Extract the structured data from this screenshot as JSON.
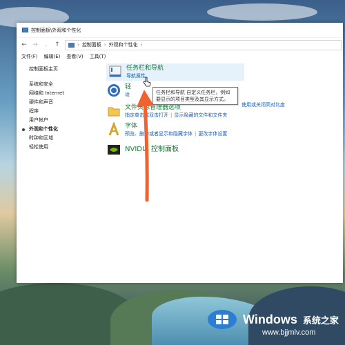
{
  "window": {
    "title": "控制面板\\外观和个性化"
  },
  "address": {
    "crumbs": [
      "控制面板",
      "外观和个性化"
    ]
  },
  "menu": [
    "文件(F)",
    "编辑(E)",
    "查看(V)",
    "工具(T)"
  ],
  "sidebar": {
    "home": "控制面板主页",
    "items": [
      "系统和安全",
      "网络和 Internet",
      "硬件和声音",
      "程序",
      "用户帐户",
      "外观和个性化",
      "时钟和区域",
      "轻松使用"
    ],
    "active_index": 5
  },
  "categories": {
    "taskbar": {
      "title": "任务栏和导航",
      "links": [
        "导航属性"
      ]
    },
    "ease": {
      "title": "轻",
      "links": [
        "适"
      ]
    },
    "explorer": {
      "title": "文件资源管理器选项",
      "links": [
        "指定单击或双击打开",
        "显示隐藏的文件和文件夹"
      ]
    },
    "fonts": {
      "title": "字体",
      "links": [
        "预览、删除或者显示和隐藏字体",
        "更改字体设置"
      ]
    },
    "nvidia": {
      "title": "NVIDIA 控制面板",
      "links": []
    }
  },
  "tooltip": {
    "text": "任务栏和导航 自定义任务栏，例如要显示的项目类型及其显示方式。"
  },
  "right_link": "使用或关闭高对比度",
  "watermark": {
    "brand": "Windows",
    "cn": "系统之家",
    "url": "www.bjjmlv.com"
  },
  "colors": {
    "accent_arrow": "#f0622f",
    "link": "#1a5fb4",
    "category_title": "#1a7a3a"
  }
}
